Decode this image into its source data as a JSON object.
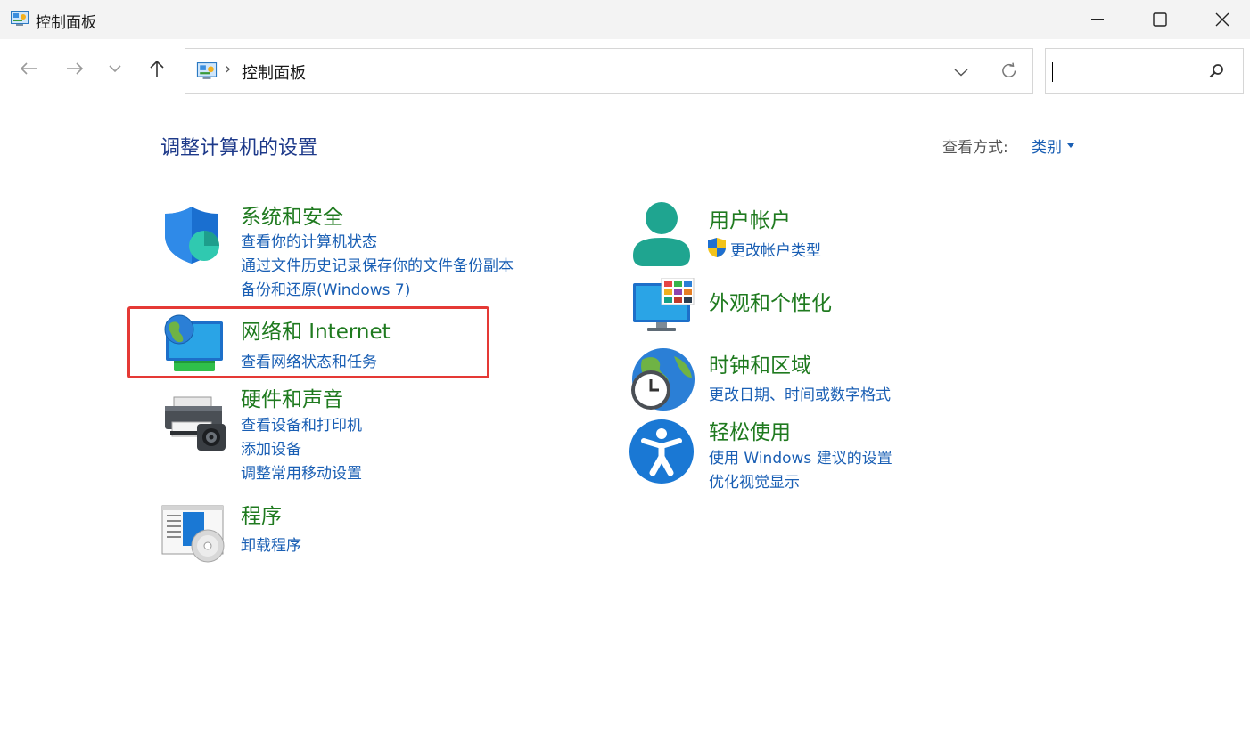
{
  "window": {
    "title": "控制面板"
  },
  "address": {
    "separator": "›",
    "path": "控制面板"
  },
  "search": {
    "value": ""
  },
  "main": {
    "heading": "调整计算机的设置",
    "view_by_label": "查看方式:",
    "view_by_value": "类别"
  },
  "categories": [
    {
      "id": "system-security",
      "title": "系统和安全",
      "links": [
        "查看你的计算机状态",
        "通过文件历史记录保存你的文件备份副本",
        "备份和还原(Windows 7)"
      ]
    },
    {
      "id": "network-internet",
      "title": "网络和 Internet",
      "links": [
        "查看网络状态和任务"
      ]
    },
    {
      "id": "hardware-sound",
      "title": "硬件和声音",
      "links": [
        "查看设备和打印机",
        "添加设备",
        "调整常用移动设置"
      ]
    },
    {
      "id": "programs",
      "title": "程序",
      "links": [
        "卸载程序"
      ]
    },
    {
      "id": "user-accounts",
      "title": "用户帐户",
      "links": [
        "更改帐户类型"
      ]
    },
    {
      "id": "appearance",
      "title": "外观和个性化",
      "links": []
    },
    {
      "id": "clock-region",
      "title": "时钟和区域",
      "links": [
        "更改日期、时间或数字格式"
      ]
    },
    {
      "id": "ease-of-access",
      "title": "轻松使用",
      "links": [
        "使用 Windows 建议的设置",
        "优化视觉显示"
      ]
    }
  ],
  "colors": {
    "heading": "#1e3a8a",
    "category_title": "#1f7a1f",
    "link": "#1a5fb4",
    "highlight": "#e53935"
  },
  "icons": {
    "system-security": "shield-icon",
    "network-internet": "globe-monitor-icon",
    "hardware-sound": "printer-icon",
    "programs": "program-disc-icon",
    "user-accounts": "user-icon",
    "appearance": "monitor-palette-icon",
    "clock-region": "globe-clock-icon",
    "ease-of-access": "accessibility-icon"
  }
}
